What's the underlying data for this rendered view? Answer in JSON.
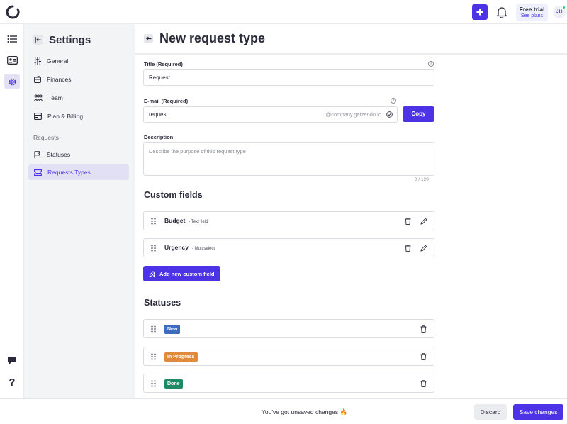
{
  "topbar": {
    "trial_title": "Free trial",
    "trial_link": "See plans",
    "avatar_initials": "JH",
    "accent": "#4c33e6"
  },
  "sidebar": {
    "title": "Settings",
    "items": [
      {
        "label": "General",
        "icon": "sliders-icon"
      },
      {
        "label": "Finances",
        "icon": "wallet-icon"
      },
      {
        "label": "Team",
        "icon": "team-icon"
      },
      {
        "label": "Plan & Billing",
        "icon": "billing-icon"
      }
    ],
    "section_label": "Requests",
    "request_items": [
      {
        "label": "Statuses",
        "icon": "flag-icon"
      },
      {
        "label": "Requests Types",
        "icon": "ticket-icon",
        "active": true
      }
    ]
  },
  "page": {
    "title": "New request type"
  },
  "form": {
    "title_label": "Title (Required)",
    "title_value": "Request",
    "email_label": "E-mail (Required)",
    "email_value": "request",
    "email_suffix": "@company.getzendo.io",
    "copy_label": "Copy",
    "description_label": "Description",
    "description_placeholder": "Describe the purpose of this request type",
    "description_counter": "0 / 120"
  },
  "custom_fields": {
    "title": "Custom fields",
    "items": [
      {
        "name": "Budget",
        "type": "- Text field"
      },
      {
        "name": "Urgency",
        "type": "- Multiselect"
      }
    ],
    "add_label": "Add new custom field"
  },
  "statuses": {
    "title": "Statuses",
    "items": [
      {
        "name": "New",
        "color": "#3d6bc4"
      },
      {
        "name": "In Progress",
        "color": "#e08a3c"
      },
      {
        "name": "Done",
        "color": "#1f8a65"
      }
    ]
  },
  "footer": {
    "message": "You've got unsaved changes 🔥",
    "discard_label": "Discard",
    "save_label": "Save changes"
  }
}
